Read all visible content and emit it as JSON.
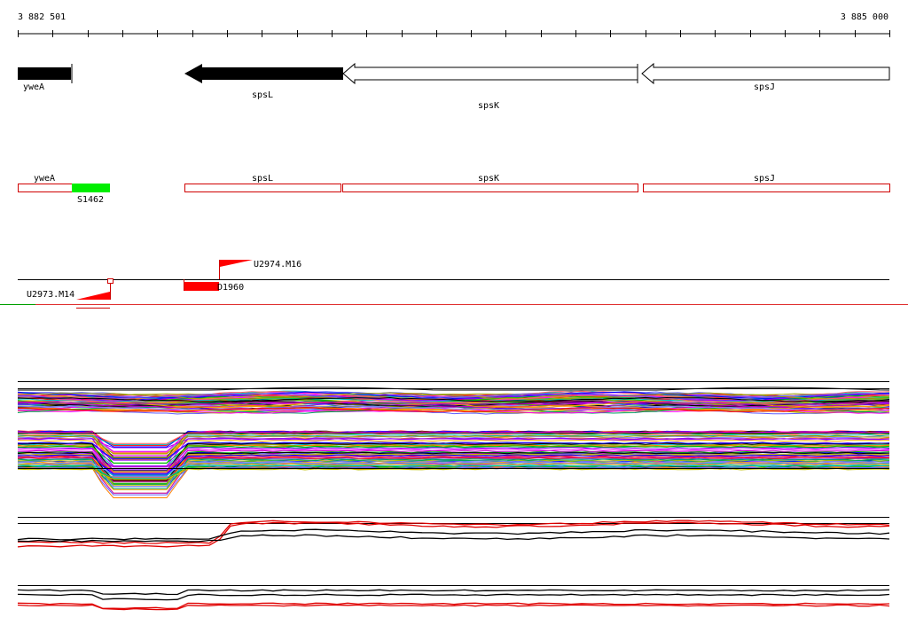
{
  "coordinate_axis": {
    "start_label": "3 882 501",
    "end_label": "3 885 000"
  },
  "annotated_genes": [
    {
      "name": "yweA",
      "strand": "reverse",
      "fill": "black"
    },
    {
      "name": "spsL",
      "strand": "reverse",
      "fill": "black"
    },
    {
      "name": "spsK",
      "strand": "reverse",
      "fill": "white"
    },
    {
      "name": "spsJ",
      "strand": "reverse",
      "fill": "white"
    }
  ],
  "transcription_units": [
    {
      "name": "yweA"
    },
    {
      "name": "S1462",
      "color": "#00ee00"
    },
    {
      "name": "spsL"
    },
    {
      "name": "spsK"
    },
    {
      "name": "spsJ"
    }
  ],
  "features": {
    "terminators": [
      {
        "name": "U2974.M16"
      },
      {
        "name": "U2973.M14"
      }
    ],
    "segment_label": "D1960"
  },
  "colors": {
    "gene_outline": "#d00000",
    "feature_red": "#ff0000",
    "novel_green": "#00ee00",
    "axis": "#000000"
  },
  "expression_panels": [
    {
      "name": "multi-condition-profiles-upper"
    },
    {
      "name": "multi-condition-profiles-lower"
    },
    {
      "name": "strand-profiles-red-black"
    },
    {
      "name": "strand-profiles-bottom"
    }
  ]
}
